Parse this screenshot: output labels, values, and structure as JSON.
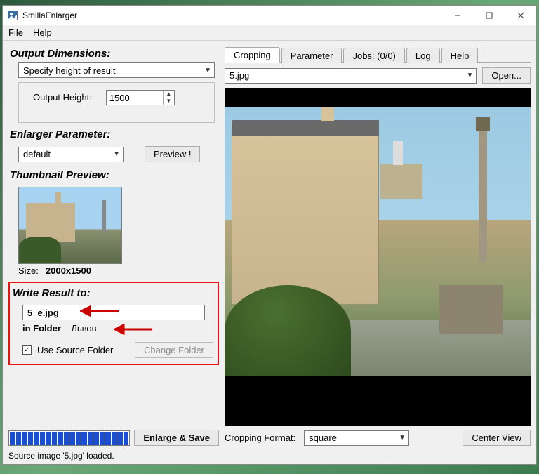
{
  "window": {
    "title": "SmillaEnlarger"
  },
  "menu": {
    "file": "File",
    "help": "Help"
  },
  "output": {
    "heading": "Output Dimensions:",
    "mode": "Specify height of result",
    "height_label": "Output Height:",
    "height_value": "1500"
  },
  "enlarger": {
    "heading": "Enlarger Parameter:",
    "preset": "default",
    "preview_btn": "Preview !"
  },
  "thumbnail": {
    "heading": "Thumbnail Preview:",
    "size_label": "Size:",
    "size_value": "2000x1500"
  },
  "write": {
    "heading": "Write Result to:",
    "filename": "5_e.jpg",
    "folder_label": "in Folder",
    "folder_value": "Львов",
    "use_source_label": "Use Source Folder",
    "use_source_checked": "✓",
    "change_folder_btn": "Change Folder"
  },
  "enlarge_btn": "Enlarge & Save",
  "tabs": {
    "cropping": "Cropping",
    "parameter": "Parameter",
    "jobs": "Jobs: (0/0)",
    "log": "Log",
    "help": "Help"
  },
  "file": {
    "current": "5.jpg",
    "open_btn": "Open..."
  },
  "cropping": {
    "format_label": "Cropping Format:",
    "format_value": "square",
    "center_btn": "Center View"
  },
  "status": "Source image '5.jpg' loaded."
}
